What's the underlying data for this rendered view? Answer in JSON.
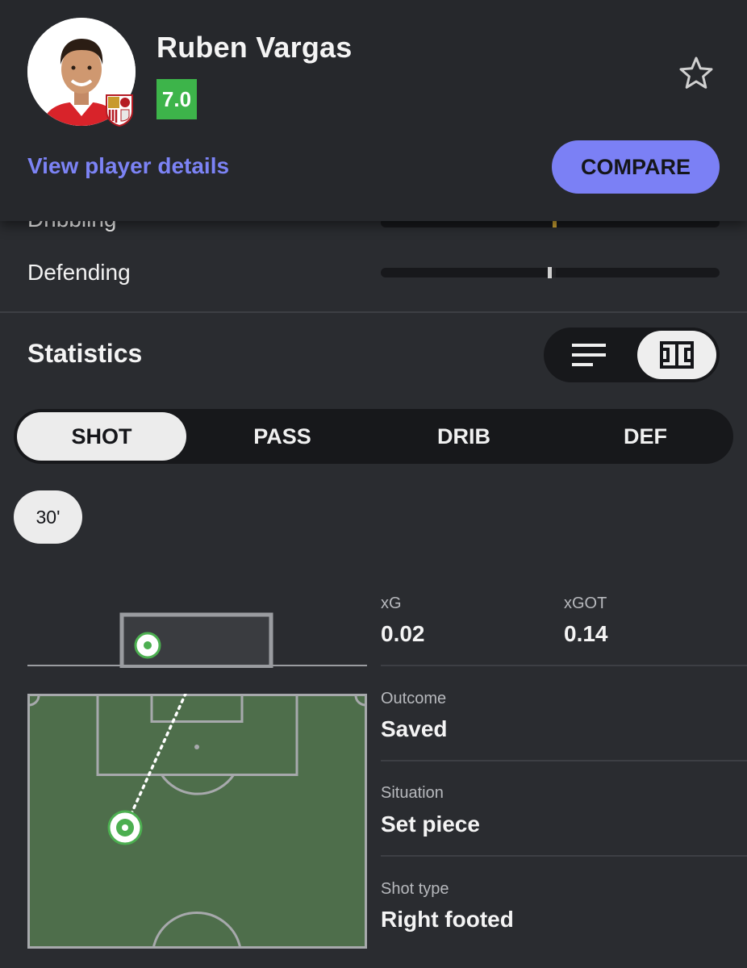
{
  "player": {
    "name": "Ruben Vargas",
    "rating": "7.0",
    "details_link": "View player details",
    "compare_label": "COMPARE"
  },
  "attributes": [
    {
      "label": "Dribbling"
    },
    {
      "label": "Defending"
    }
  ],
  "statistics": {
    "title": "Statistics",
    "view_options": [
      "list-view-icon",
      "pitch-view-icon"
    ],
    "selected_view": "pitch-view-icon",
    "tabs": [
      "SHOT",
      "PASS",
      "DRIB",
      "DEF"
    ],
    "active_tab": "SHOT",
    "minute": "30'"
  },
  "shot": {
    "xg_label": "xG",
    "xg_value": "0.02",
    "xgot_label": "xGOT",
    "xgot_value": "0.14",
    "outcome_label": "Outcome",
    "outcome_value": "Saved",
    "situation_label": "Situation",
    "situation_value": "Set piece",
    "shot_type_label": "Shot type",
    "shot_type_value": "Right footed"
  },
  "colors": {
    "background": "#2a2c30",
    "accent": "#7b80f5",
    "rating_green": "#3db44a",
    "pitch_green": "#4e6e4b"
  }
}
